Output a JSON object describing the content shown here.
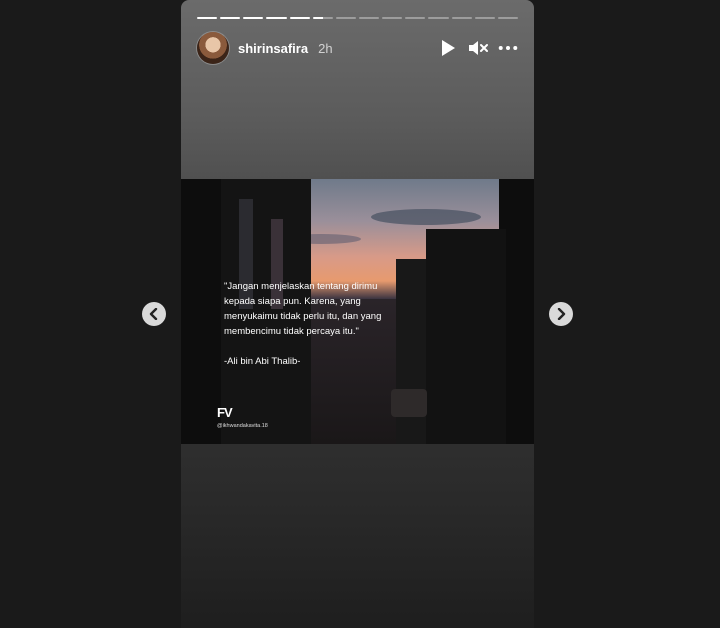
{
  "story": {
    "progress": {
      "total": 14,
      "completed": 5,
      "current_fraction": 0.5
    },
    "user": {
      "username": "shirinsafira",
      "time_ago": "2h"
    },
    "controls": {
      "play_icon": "play-icon",
      "mute_icon": "muted-speaker-icon",
      "more_icon": "more-options-icon"
    },
    "post": {
      "quote": "\"Jangan menjelaskan tentang dirimu\nkepada siapa pun. Karena, yang\nmenyukaimu tidak perlu itu, dan yang\nmembencimu tidak percaya itu.\"",
      "author": "-Ali bin Abi Thalib-",
      "watermark_logo": "FV",
      "watermark_handle": "@ikhwandakavita.18"
    }
  },
  "nav": {
    "prev_icon": "chevron-left-icon",
    "next_icon": "chevron-right-icon"
  }
}
